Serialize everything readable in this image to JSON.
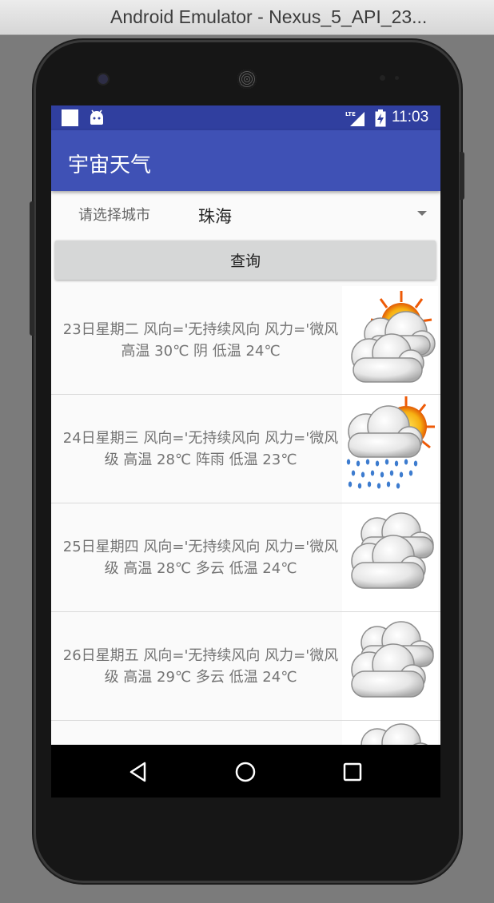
{
  "window": {
    "title": "Android Emulator - Nexus_5_API_23..."
  },
  "status_bar": {
    "time": "11:03",
    "network": "LTE"
  },
  "app": {
    "title": "宇宙天气"
  },
  "city": {
    "label": "请选择城市",
    "selected": "珠海"
  },
  "query_button": {
    "label": "查询"
  },
  "forecast": [
    {
      "day": "23日星期二",
      "text": "23日星期二  风向='无持续风向  风力='微风  高温 30℃ 阴 低温 24℃",
      "icon": "partly-cloudy-icon"
    },
    {
      "day": "24日星期三",
      "text": "24日星期三  风向='无持续风向  风力='微风级  高温 28℃ 阵雨 低温 23℃",
      "icon": "shower-icon"
    },
    {
      "day": "25日星期四",
      "text": "25日星期四  风向='无持续风向  风力='微风级  高温 28℃ 多云 低温 24℃",
      "icon": "cloudy-icon"
    },
    {
      "day": "26日星期五",
      "text": "26日星期五  风向='无持续风向  风力='微风级  高温 29℃ 多云 低温 24℃",
      "icon": "cloudy-icon"
    },
    {
      "day": "",
      "text": "",
      "icon": "cloudy-icon"
    }
  ],
  "nav": {
    "back": "back-icon",
    "home": "home-icon",
    "recents": "recents-icon"
  },
  "colors": {
    "primary": "#3f51b5",
    "primary_dark": "#303f9f",
    "list_text": "#737373"
  }
}
